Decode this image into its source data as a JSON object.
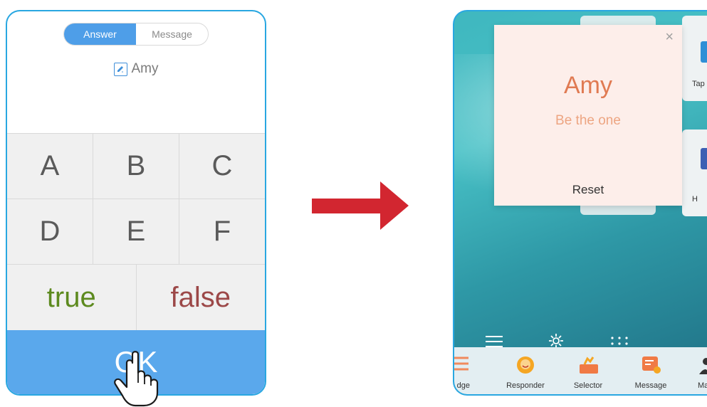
{
  "left_phone": {
    "tabs": [
      {
        "label": "Answer",
        "active": true
      },
      {
        "label": "Message",
        "active": false
      }
    ],
    "user_name": "Amy",
    "keys": {
      "row1": [
        "A",
        "B",
        "C"
      ],
      "row2": [
        "D",
        "E",
        "F"
      ],
      "row3": [
        "true",
        "false"
      ]
    },
    "ok_label": "OK"
  },
  "right_phone": {
    "popup": {
      "name": "Amy",
      "subtitle": "Be the one",
      "reset_label": "Reset",
      "close_glyph": "×"
    },
    "side_tiles": [
      "Tap",
      "H"
    ],
    "dock": [
      {
        "label": "dge",
        "icon": "list-icon"
      },
      {
        "label": "Responder",
        "icon": "responder-icon"
      },
      {
        "label": "Selector",
        "icon": "selector-icon"
      },
      {
        "label": "Message",
        "icon": "message-icon"
      },
      {
        "label": "Ma",
        "icon": "person-icon"
      }
    ]
  },
  "colors": {
    "accent_blue": "#5aa8ec",
    "frame_blue": "#29a7e1",
    "arrow_red": "#d22630",
    "true_green": "#5d8a1f",
    "false_red": "#9c4848",
    "popup_name": "#e07a52"
  }
}
